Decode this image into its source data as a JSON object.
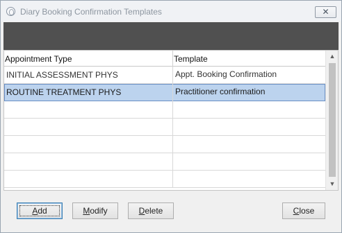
{
  "window": {
    "title": "Diary Booking Confirmation Templates",
    "close_symbol": "✕"
  },
  "grid": {
    "columns": [
      "Appointment Type",
      "Template"
    ],
    "rows": [
      {
        "appointment_type": "INITIAL ASSESSMENT PHYS",
        "template": "Appt. Booking Confirmation",
        "selected": false
      },
      {
        "appointment_type": "ROUTINE TREATMENT PHYS",
        "template": "Practitioner confirmation",
        "selected": true
      },
      {
        "appointment_type": "",
        "template": "",
        "selected": false
      },
      {
        "appointment_type": "",
        "template": "",
        "selected": false
      },
      {
        "appointment_type": "",
        "template": "",
        "selected": false
      },
      {
        "appointment_type": "",
        "template": "",
        "selected": false
      },
      {
        "appointment_type": "",
        "template": "",
        "selected": false
      }
    ],
    "scroll_up_symbol": "▲",
    "scroll_down_symbol": "▼"
  },
  "buttons": {
    "add": {
      "mnemonic": "A",
      "rest": "dd"
    },
    "modify": {
      "mnemonic": "M",
      "rest": "odify"
    },
    "delete": {
      "mnemonic": "D",
      "rest": "elete"
    },
    "close": {
      "mnemonic": "C",
      "rest": "lose"
    }
  },
  "colors": {
    "selected_row": "#bcd3ee",
    "header_band": "#505050"
  }
}
